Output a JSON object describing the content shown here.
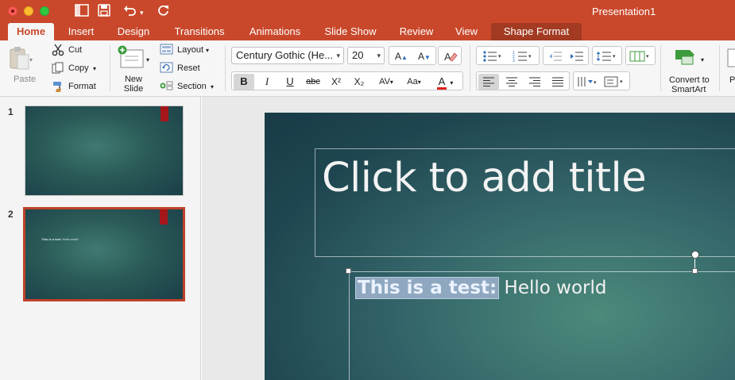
{
  "window": {
    "title": "Presentation1"
  },
  "colors": {
    "accent": "#c9482b",
    "slide_dark": "#1f4650",
    "slide_light": "#4c8a7b",
    "selection_border": "#c0412a"
  },
  "tabs": [
    {
      "label": "Home",
      "active": true
    },
    {
      "label": "Insert"
    },
    {
      "label": "Design"
    },
    {
      "label": "Transitions"
    },
    {
      "label": "Animations"
    },
    {
      "label": "Slide Show"
    },
    {
      "label": "Review"
    },
    {
      "label": "View"
    },
    {
      "label": "Shape Format",
      "contextual": true
    }
  ],
  "ribbon": {
    "paste": "Paste",
    "cut": "Cut",
    "copy": "Copy",
    "format": "Format",
    "new_slide_line1": "New",
    "new_slide_line2": "Slide",
    "layout": "Layout",
    "reset": "Reset",
    "section": "Section",
    "font_name": "Century Gothic (He...",
    "font_size": "20",
    "bold": "B",
    "italic": "I",
    "underline": "U",
    "strike": "abc",
    "superscript": "X²",
    "subscript": "X₂",
    "convert_line1": "Convert to",
    "convert_line2": "SmartArt",
    "cut_off_label": "P"
  },
  "slides": [
    {
      "number": "1",
      "text": ""
    },
    {
      "number": "2",
      "text_bold": "This is a test:",
      "text_rest": " Hello world",
      "selected": true
    }
  ],
  "current_slide": {
    "title_placeholder": "Click to add title",
    "body_selected": "This is a test:",
    "body_rest": "Hello world"
  }
}
